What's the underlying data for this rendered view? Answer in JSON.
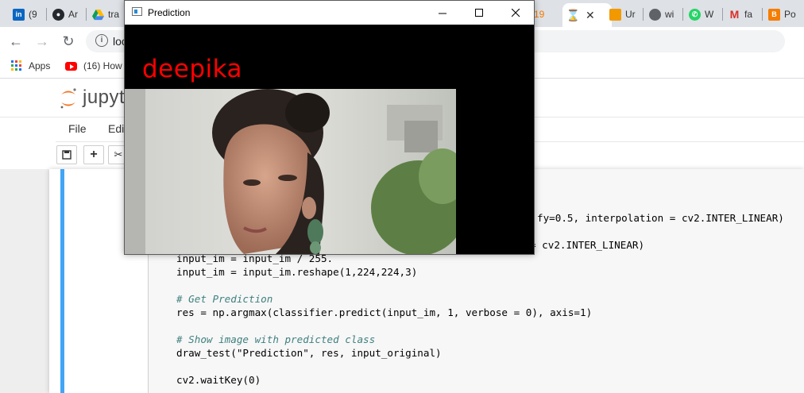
{
  "browser": {
    "tabs": [
      {
        "label": "(9",
        "color": "#0a66c2",
        "glyph": "in"
      },
      {
        "label": "Ar",
        "color": "#24292e",
        "glyph": "gh"
      },
      {
        "label": "tra",
        "color": "#1fa463",
        "glyph": "drive"
      },
      {
        "label": "19",
        "color": "#f57c00",
        "glyph": "orange"
      },
      {
        "label": "",
        "color": "#f4b400",
        "glyph": "hourglass",
        "active": true
      },
      {
        "label": "Ur",
        "color": "#f29900",
        "glyph": "book"
      },
      {
        "label": "wi",
        "color": "#5f6368",
        "glyph": "globe"
      },
      {
        "label": "W",
        "color": "#25d366",
        "glyph": "whatsapp"
      },
      {
        "label": "fa",
        "color": "#d93025",
        "glyph": "gmail"
      },
      {
        "label": "Po",
        "color": "#f57d00",
        "glyph": "blogger"
      }
    ],
    "omnibox_text": "loc",
    "bookmarks": [
      {
        "label": "Apps",
        "icon": "apps-grid-icon"
      },
      {
        "label": "(16) How",
        "icon": "youtube-icon"
      }
    ]
  },
  "jupyter": {
    "logo_text": "jupyt",
    "menu": [
      "File",
      "Edi"
    ],
    "toolbar_icons": [
      "save-icon",
      "add-cell-icon",
      "cut-icon"
    ]
  },
  "code": {
    "line1_tail": "fy=0.5, interpolation = cv2.INTER_LINEAR)",
    "line2_tail": "= cv2.INTER_LINEAR)",
    "line3": "input_im = input_im / 255.",
    "line4": "input_im = input_im.reshape(1,224,224,3)",
    "comment1": "# Get Prediction",
    "line5": "res = np.argmax(classifier.predict(input_im, 1, verbose = 0), axis=1)",
    "comment2": "# Show image with predicted class",
    "line6": "draw_test(\"Prediction\", res, input_original)",
    "line7": "cv2.waitKey(0)"
  },
  "cv_window": {
    "title": "Prediction",
    "prediction_label": "deepika",
    "prediction_color": "#ff0000"
  }
}
